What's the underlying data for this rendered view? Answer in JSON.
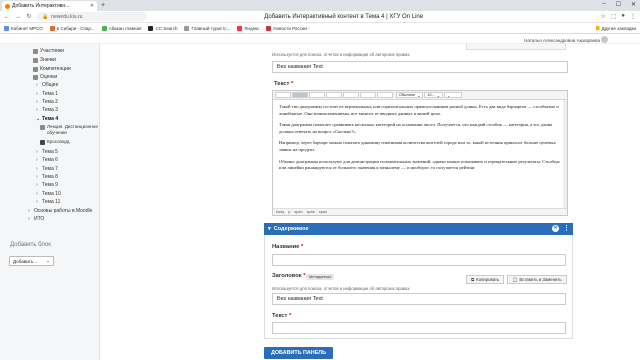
{
  "browser": {
    "tab_title": "Добавить Интерактивн...",
    "url": "newedu.kiu.ru",
    "page_title": "Добавить Интерактивный контент в Тема 4 | ХГУ On Line",
    "bookmarks": [
      "Кабинет МРСО",
      "в Сибири - Спар...",
      "Абакан главная",
      "CC Search",
      "Главный туристс...",
      "Яндекс",
      "Новости России -"
    ],
    "other_bookmarks": "Другие закладки"
  },
  "header": {
    "user_name": "Наталья Александровна Акшараева"
  },
  "sidebar": {
    "items": [
      {
        "label": "Участники",
        "type": "icon"
      },
      {
        "label": "Значки",
        "type": "icon"
      },
      {
        "label": "Компетенции",
        "type": "icon"
      },
      {
        "label": "Оценки",
        "type": "icon"
      },
      {
        "label": "Общее",
        "type": "chev"
      },
      {
        "label": "Тема 1",
        "type": "chev"
      },
      {
        "label": "Тема 2",
        "type": "chev"
      },
      {
        "label": "Тема 3",
        "type": "chev"
      },
      {
        "label": "Тема 4",
        "type": "open"
      }
    ],
    "sub_items": [
      "Лекция. Дистанционное",
      "обучение",
      "Кроссворд"
    ],
    "items2": [
      "Тема 5",
      "Тема 6",
      "Тема 7",
      "Тема 8",
      "Тема 9",
      "Тема 10",
      "Тема 11",
      "Основы работы в Moodle",
      "ИТО"
    ],
    "add_block_title": "Добавить блок",
    "add_block_select": "Добавить..."
  },
  "form": {
    "hint_top": "Используется для поиска, отчетов и информации об авторских правах.",
    "title_value": "Без названия Text",
    "text_label": "Текст",
    "editor": {
      "format_select": "Обычное",
      "size_select": "10...",
      "paragraphs": [
        "Такой тип диаграммы состоит из вертикальных или горизонтальных прямоугольников разной длины. Есть два вида барчартов — столбчатые и линейчатые. Они взаимозаменяемы, все зависит от вводных данных и вашей цели.",
        "Такая диаграмма помогает сравнивать несколько категорий на основании чисел. Получается, что каждый столбик — категория, а его длина должна отвечать на вопрос «Сколько?».",
        "Например, через барчарт можно показать динамику изменения количества жителей города или то, какой источник приносит больше целевых заявок на продукт.",
        "Обычно диаграммы используют для демонстрации положительных значений, однако можно показывать и отрицательные результаты. Столбцы или линейки ранжируются от большего значения к меньшему — и ниоборот, то получается рейтинг."
      ],
      "status_path": [
        "body",
        "p",
        "span",
        "span",
        "span"
      ]
    },
    "section_title": "Содержимое",
    "name_label": "Название",
    "heading_label": "Заголовок",
    "heading_badge": "Метаданные",
    "copy_button": "Копировать",
    "paste_button": "Вставить и Заменить",
    "hint_bottom": "Используется для поиска, отчетов и информации об авторских правах.",
    "title_value2": "Без названия Text",
    "text_label2": "Текст",
    "add_panel_button": "ДОБАВИТЬ ПАНЕЛЬ"
  }
}
